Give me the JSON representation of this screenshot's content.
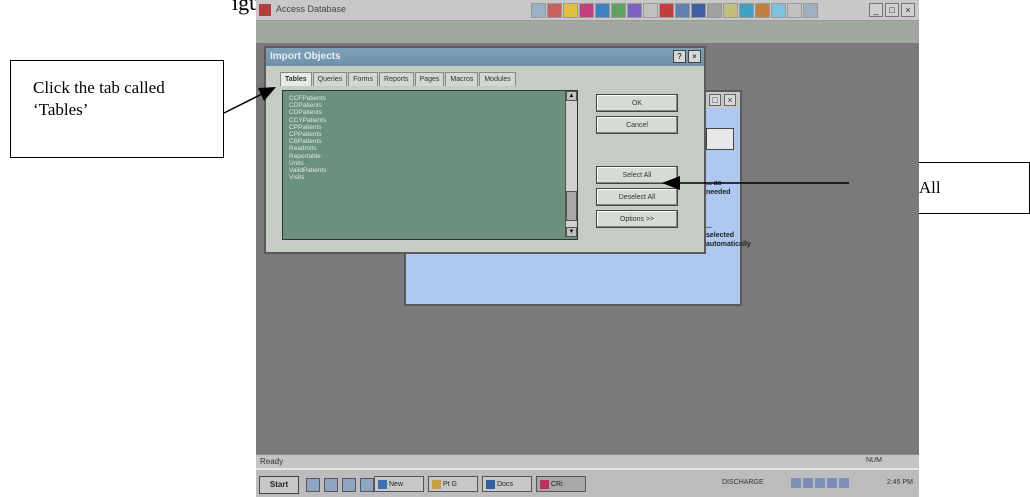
{
  "callouts": {
    "left": "Click the tab called ‘Tables’",
    "right": "Select All"
  },
  "app": {
    "title": "Access Database"
  },
  "dialog": {
    "title": "Import Objects",
    "tabs": [
      "Tables",
      "Queries",
      "Forms",
      "Reports",
      "Pages",
      "Macros",
      "Modules"
    ],
    "active_tab": "Tables",
    "list_items": [
      "CCFPatients",
      "CDPatients",
      "CDPatients",
      "CCYPatients",
      "CPPatients",
      "CPPatients",
      "CBPatients",
      "Readmits",
      "Reportable",
      "Units",
      "ValidPatients",
      "Visits"
    ],
    "buttons": {
      "ok": "OK",
      "cancel": "Cancel",
      "select_all": "Select All",
      "deselect_all": "Deselect All",
      "options": "Options >>"
    }
  },
  "background_window": {
    "button": "...",
    "text1": "... as needed",
    "text2": "... selected",
    "text3": "... automatically"
  },
  "statusbar": {
    "text": "Ready",
    "indicator": "NUM"
  },
  "taskbar": {
    "start": "Start",
    "tasks": [
      "New",
      "Pt G",
      "Docs",
      "CRi"
    ],
    "tray_text": "DISCHARGE",
    "clock": "2:45 PM"
  }
}
